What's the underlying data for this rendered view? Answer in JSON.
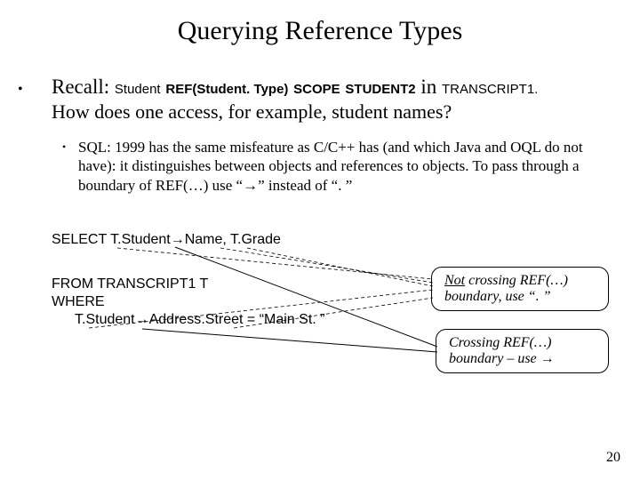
{
  "title": "Querying Reference Types",
  "recall": {
    "label": "Recall:",
    "code_student": "Student",
    "code_ref": "REF(Student. Type)",
    "code_scope": "SCOPE",
    "code_student2": "STUDENT2",
    "in": "in",
    "code_trans": "TRANSCRIPT1.",
    "howline": "How does one access, for example, student names?"
  },
  "subbullet": "SQL: 1999 has the same misfeature as C/C++ has (and which Java and OQL do not have):  it distinguishes between objects and references to objects. To pass through a boundary of REF(…) use “→” instead of “. ”",
  "sql": {
    "select": "SELECT  T",
    "dot": ".",
    "student": "Student",
    "arrow": "→",
    "name": "Name, T",
    "grade": "Grade",
    "from": "FROM  TRANSCRIPT1  T",
    "where": "WHERE",
    "l4a": "T",
    "l4b": "Student",
    "l4c": "Address",
    "l4d": "Street = “Main St. ”"
  },
  "callout1": {
    "not": "Not",
    "text1": " crossing REF(…)",
    "text2": "boundary, use “. ”"
  },
  "callout2": {
    "text1": "Crossing REF(…)",
    "text2": "boundary – use →"
  },
  "pagenum": "20"
}
